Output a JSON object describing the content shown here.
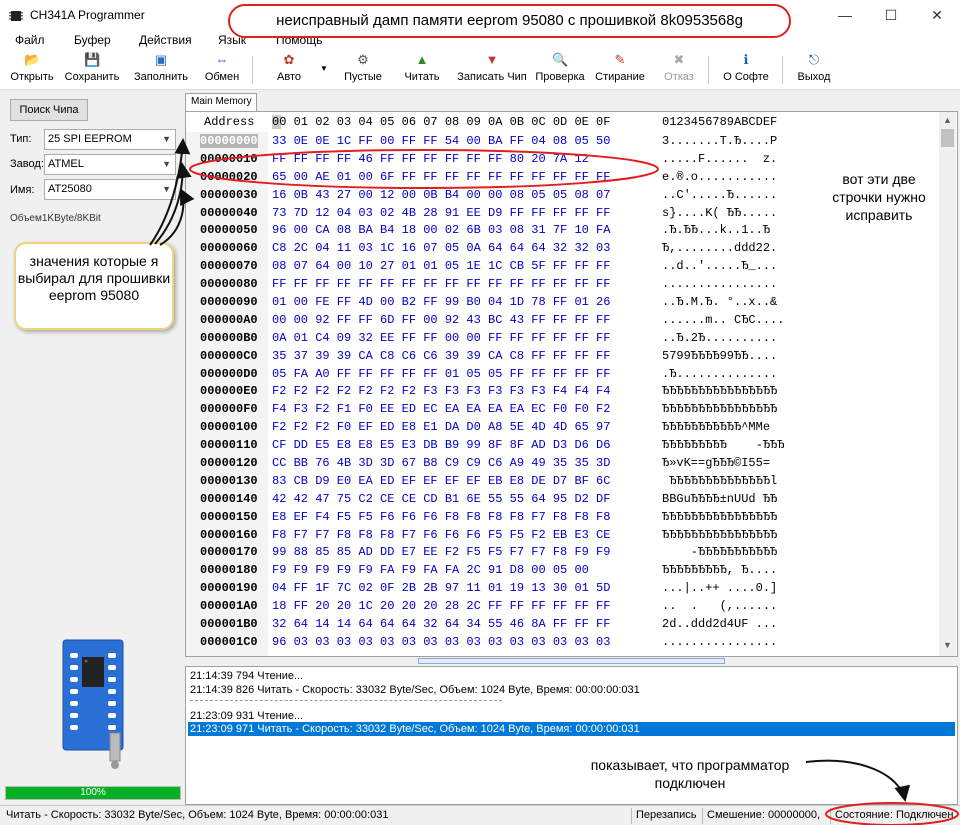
{
  "window": {
    "title": "CH341A Programmer",
    "minimize": "—",
    "maximize": "☐",
    "close": "✕"
  },
  "menu": [
    "Файл",
    "Буфер",
    "Действия",
    "Язык",
    "Помощь"
  ],
  "toolbar": [
    {
      "label": "Открыть",
      "icon": "folder-open-icon",
      "glyph": "📂"
    },
    {
      "label": "Сохранить",
      "icon": "save-icon",
      "glyph": "💾"
    },
    {
      "label": "Заполнить",
      "icon": "fill-icon",
      "glyph": "▣"
    },
    {
      "label": "Обмен",
      "icon": "swap-icon",
      "glyph": "⇔"
    },
    {
      "label": "Авто",
      "icon": "auto-icon",
      "glyph": "✿"
    },
    {
      "label": "Пустые",
      "icon": "blank-check-icon",
      "glyph": "⚙"
    },
    {
      "label": "Читать",
      "icon": "read-icon",
      "glyph": "▲"
    },
    {
      "label": "Записать Чип",
      "icon": "write-icon",
      "glyph": "▼"
    },
    {
      "label": "Проверка",
      "icon": "verify-icon",
      "glyph": "🔍"
    },
    {
      "label": "Стирание",
      "icon": "erase-icon",
      "glyph": "✎"
    },
    {
      "label": "Отказ",
      "icon": "cancel-icon",
      "glyph": "✖"
    },
    {
      "label": "О Софте",
      "icon": "info-icon",
      "glyph": "ℹ"
    },
    {
      "label": "Выход",
      "icon": "exit-icon",
      "glyph": "⎋"
    }
  ],
  "left": {
    "search_button": "Поиск Чипа",
    "type_label": "Тип:",
    "type_value": "25 SPI EEPROM",
    "vendor_label": "Завод:",
    "vendor_value": "ATMEL",
    "name_label": "Имя:",
    "name_value": "AT25080",
    "volume": "Объем1KByte/8KBit",
    "progress": "100%"
  },
  "tab": "Main Memory",
  "hex": {
    "address_header": "Address",
    "columns_header": "00 01 02 03 04 05 06 07 08 09 0A 0B 0C 0D 0E 0F",
    "ascii_header": "0123456789ABCDEF",
    "rows": [
      {
        "a": "00000000",
        "h": "33 0E 0E 1C FF 00 FF FF 54 00 BA FF 04 08 05 50",
        "s": "3.......T.Ђ....P"
      },
      {
        "a": "00000010",
        "h": "FF FF FF FF 46 FF FF FF FF FF FF 80 20 7A 12",
        "s": ".....F......  z."
      },
      {
        "a": "00000020",
        "h": "65 00 AE 01 00 6F FF FF FF FF FF FF FF FF FF FF",
        "s": "e.®.o..........."
      },
      {
        "a": "00000030",
        "h": "16 0B 43 27 00 12 00 0B B4 00 00 08 05 05 08 07",
        "s": "..C'.....Ђ......"
      },
      {
        "a": "00000040",
        "h": "73 7D 12 04 03 02 4B 28 91 EE D9 FF FF FF FF FF",
        "s": "s}....K( ЂЂ....."
      },
      {
        "a": "00000050",
        "h": "96 00 CA 08 BA B4 18 00 02 6B 03 08 31 7F 10 FA",
        "s": ".Ђ.ЂЂ...k..1..Ђ"
      },
      {
        "a": "00000060",
        "h": "C8 2C 04 11 03 1C 16 07 05 0A 64 64 64 32 32 03",
        "s": "Ђ,........ddd22."
      },
      {
        "a": "00000070",
        "h": "08 07 64 00 10 27 01 01 05 1E 1C CB 5F FF FF FF",
        "s": "..d..'.....Ђ_..."
      },
      {
        "a": "00000080",
        "h": "FF FF FF FF FF FF FF FF FF FF FF FF FF FF FF FF",
        "s": "................"
      },
      {
        "a": "00000090",
        "h": "01 00 FE FF 4D 00 B2 FF 99 B0 04 1D 78 FF 01 26",
        "s": "..Ђ.M.Ђ. °..x..&"
      },
      {
        "a": "000000A0",
        "h": "00 00 92 FF FF 6D FF 00 92 43 BC 43 FF FF FF FF",
        "s": "......m.. СЂС...."
      },
      {
        "a": "000000B0",
        "h": "0A 01 C4 09 32 EE FF FF 00 00 FF FF FF FF FF FF",
        "s": "..Ђ.2Ђ.........."
      },
      {
        "a": "000000C0",
        "h": "35 37 39 39 CA C8 C6 C6 39 39 CA C8 FF FF FF FF",
        "s": "5799ЂЂЂЂ99ЂЂ...."
      },
      {
        "a": "000000D0",
        "h": "05 FA A0 FF FF FF FF FF 01 05 05 FF FF FF FF FF",
        "s": ".Ђ.............."
      },
      {
        "a": "000000E0",
        "h": "F2 F2 F2 F2 F2 F2 F2 F3 F3 F3 F3 F3 F3 F4 F4 F4",
        "s": "ЂЂЂЂЂЂЂЂЂЂЂЂЂЂЂЂ"
      },
      {
        "a": "000000F0",
        "h": "F4 F3 F2 F1 F0 EE ED EC EA EA EA EA EC F0 F0 F2",
        "s": "ЂЂЂЂЂЂЂЂЂЂЂЂЂЂЂЂ"
      },
      {
        "a": "00000100",
        "h": "F2 F2 F2 F0 EF ED E8 E1 DA D0 A8 5E 4D 4D 65 97",
        "s": "ЂЂЂЂЂЂЂЂЂЂЂ^MMe"
      },
      {
        "a": "00000110",
        "h": "CF DD E5 E8 E8 E5 E3 DB B9 99 8F 8F AD D3 D6 D6",
        "s": "ЂЂЂЂЂЂЂЂЂ    -ЂЂЂ"
      },
      {
        "a": "00000120",
        "h": "CC BB 76 4B 3D 3D 67 B8 C9 C9 C6 A9 49 35 35 3D",
        "s": "Ђ»vK==gЂЂЂ©I55="
      },
      {
        "a": "00000130",
        "h": "83 CB D9 E0 EA ED EF EF EF EF EB E8 DE D7 BF 6C",
        "s": " ЂЂЂЂЂЂЂЂЂЂЂЂЂЂl"
      },
      {
        "a": "00000140",
        "h": "42 42 47 75 C2 CE CE CD B1 6E 55 55 64 95 D2 DF",
        "s": "BBGuЂЂЂЂ±nUUd ЂЂ"
      },
      {
        "a": "00000150",
        "h": "E8 EF F4 F5 F5 F6 F6 F6 F8 F8 F8 F8 F7 F8 F8 F8",
        "s": "ЂЂЂЂЂЂЂЂЂЂЂЂЂЂЂЂ"
      },
      {
        "a": "00000160",
        "h": "F8 F7 F7 F8 F8 F8 F7 F6 F6 F6 F5 F5 F2 EB E3 CE",
        "s": "ЂЂЂЂЂЂЂЂЂЂЂЂЂЂЂЂ"
      },
      {
        "a": "00000170",
        "h": "99 88 85 85 AD DD E7 EE F2 F5 F5 F7 F7 F8 F9 F9",
        "s": "    -ЂЂЂЂЂЂЂЂЂЂЂ"
      },
      {
        "a": "00000180",
        "h": "F9 F9 F9 F9 F9 FA F9 FA FA 2C 91 D8 00 05 00",
        "s": "ЂЂЂЂЂЂЂЂЂ, Ђ...."
      },
      {
        "a": "00000190",
        "h": "04 FF 1F 7C 02 0F 2B 2B 97 11 01 19 13 30 01 5D",
        "s": "...|..++ ....0.]"
      },
      {
        "a": "000001A0",
        "h": "18 FF 20 20 1C 20 20 20 28 2C FF FF FF FF FF FF",
        "s": "..  .   (,......"
      },
      {
        "a": "000001B0",
        "h": "32 64 14 14 64 64 64 32 64 34 55 46 8A FF FF FF",
        "s": "2d..ddd2d4UF ..."
      },
      {
        "a": "000001C0",
        "h": "96 03 03 03 03 03 03 03 03 03 03 03 03 03 03 03",
        "s": "................"
      }
    ]
  },
  "log": [
    {
      "text": "21:14:39 794 Чтение...",
      "selected": false
    },
    {
      "text": "21:14:39 826 Читать - Скорость: 33032 Byte/Sec, Объем: 1024 Byte, Время: 00:00:00:031",
      "selected": false
    },
    {
      "text": "21:23:09 931 Чтение...",
      "selected": false
    },
    {
      "text": "21:23:09 971 Читать - Скорость: 33032 Byte/Sec, Объем: 1024 Byte, Время: 00:00:00:031",
      "selected": true
    }
  ],
  "status": {
    "main": "Читать - Скорость: 33032 Byte/Sec, Объем: 1024 Byte, Время: 00:00:00:031",
    "mode": "Перезапись",
    "offset": "Смешение: 00000000,",
    "state": "Состояние: Подключен"
  },
  "annotations": {
    "title": "неисправный дамп памяти eeprom 95080 с прошивкой 8k0953568g",
    "left": "значения которые я выбирал для прошивки eeprom 95080",
    "right": "вот эти две строчки нужно исправить",
    "bottom": "показывает, что программатор подключен"
  },
  "colors": {
    "hex_text": "#0000c8",
    "selection": "#0078d7",
    "progress": "#06b025",
    "annotation_red": "#e02020"
  }
}
